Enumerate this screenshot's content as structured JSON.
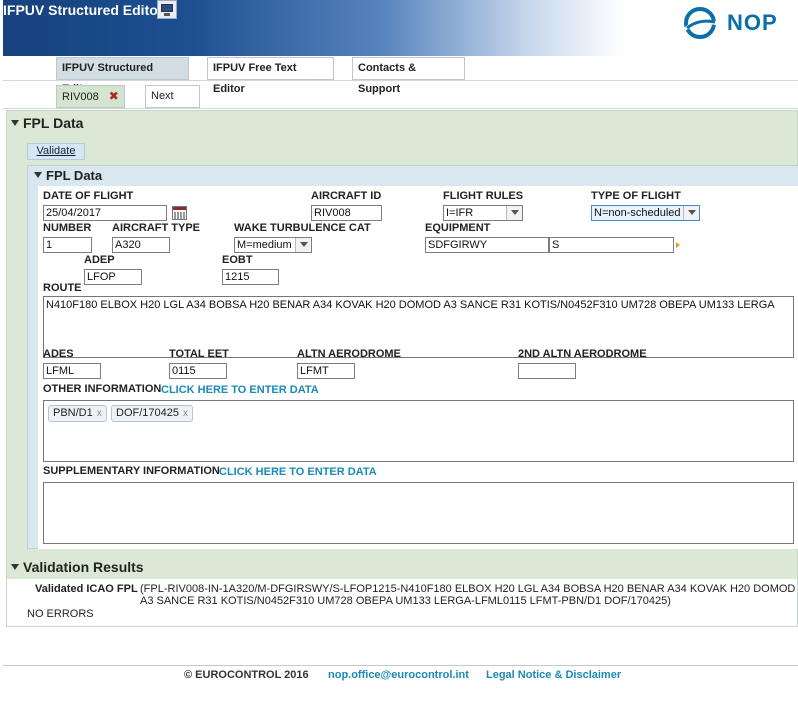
{
  "header": {
    "app_title": "IFPUV Structured Editor",
    "logo_text": "NOP",
    "brand_color": "#16427e",
    "accent_color": "#0a6ea8"
  },
  "nav_tabs": [
    {
      "label": "IFPUV Structured Editor",
      "active": true
    },
    {
      "label": "IFPUV Free Text Editor",
      "active": false
    },
    {
      "label": "Contacts & Support",
      "active": false
    }
  ],
  "doc_tabs": [
    {
      "label": "RIV008",
      "closeable": true,
      "active": true
    },
    {
      "label": "Next FPL",
      "closeable": false,
      "active": false
    }
  ],
  "fpl_section": {
    "title": "FPL Data",
    "validate_label": "Validate",
    "inner_title": "FPL Data",
    "fields": {
      "date_of_flight": {
        "label": "DATE OF FLIGHT",
        "value": "25/04/2017"
      },
      "aircraft_id": {
        "label": "AIRCRAFT ID",
        "value": "RIV008"
      },
      "flight_rules": {
        "label": "FLIGHT RULES",
        "value": "I=IFR"
      },
      "type_of_flight": {
        "label": "TYPE OF FLIGHT",
        "value": "N=non-scheduled"
      },
      "number": {
        "label": "NUMBER",
        "value": "1"
      },
      "aircraft_type": {
        "label": "AIRCRAFT TYPE",
        "value": "A320"
      },
      "wake_turbulence": {
        "label": "WAKE TURBULENCE CAT",
        "value": "M=medium"
      },
      "equipment": {
        "label": "EQUIPMENT",
        "value": "SDFGIRWY",
        "value2": "S"
      },
      "adep": {
        "label": "ADEP",
        "value": "LFOP"
      },
      "eobt": {
        "label": "EOBT",
        "value": "1215"
      },
      "route": {
        "label": "ROUTE",
        "value": "N410F180 ELBOX H20 LGL A34 BOBSA H20 BENAR A34 KOVAK H20 DOMOD A3 SANCE R31 KOTIS/N0452F310 UM728 OBEPA UM133 LERGA"
      },
      "ades": {
        "label": "ADES",
        "value": "LFML"
      },
      "total_eet": {
        "label": "TOTAL EET",
        "value": "0115"
      },
      "altn_aerodrome": {
        "label": "ALTN AERODROME",
        "value": "LFMT"
      },
      "second_altn": {
        "label": "2ND ALTN AERODROME",
        "value": ""
      },
      "other_info": {
        "label": "OTHER INFORMATION",
        "link": "CLICK HERE TO ENTER DATA",
        "tags": [
          "PBN/D1",
          "DOF/170425"
        ],
        "tag_close": "x"
      },
      "supplementary_info": {
        "label": "SUPPLEMENTARY INFORMATION",
        "link": "CLICK HERE TO ENTER DATA"
      }
    }
  },
  "validation": {
    "title": "Validation Results",
    "label": "Validated ICAO FPL",
    "line1": "(FPL-RIV008-IN-1A320/M-DFGIRSWY/S-LFOP1215-N410F180 ELBOX H20 LGL A34 BOBSA H20 BENAR A34 KOVAK H20 DOMOD",
    "line2": "A3 SANCE R31 KOTIS/N0452F310 UM728 OBEPA UM133 LERGA-LFML0115 LFMT-PBN/D1 DOF/170425)",
    "status": "NO ERRORS"
  },
  "footer": {
    "copyright": "© EUROCONTROL 2016",
    "email": "nop.office@eurocontrol.int",
    "legal": "Legal Notice & Disclaimer",
    "link_color": "#1a8ab8"
  }
}
